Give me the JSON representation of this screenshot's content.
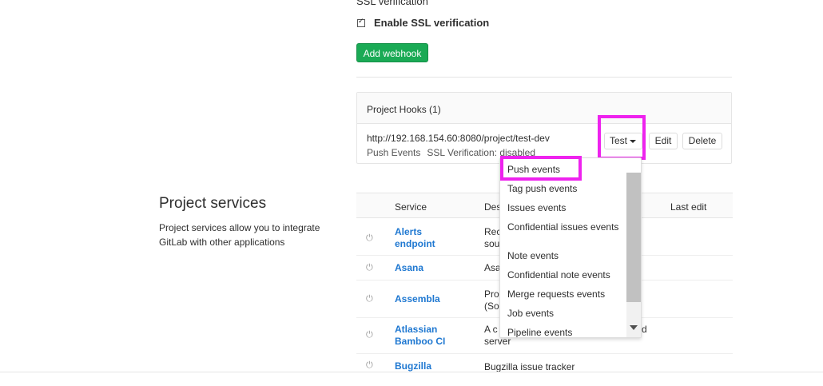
{
  "ssl": {
    "heading": "SSL verification",
    "checkbox_label": "Enable SSL verification",
    "checked": true
  },
  "add_webhook_label": "Add webhook",
  "hooks": {
    "title": "Project Hooks (1)",
    "url": "http://192.168.154.60:8080/project/test-dev",
    "tags": [
      "Push Events",
      "SSL Verification: disabled"
    ],
    "test_label": "Test",
    "edit_label": "Edit",
    "delete_label": "Delete"
  },
  "services": {
    "title": "Project services",
    "description": "Project services allow you to integrate GitLab with other applications",
    "columns": [
      "Service",
      "Des",
      "Last edit"
    ],
    "rows": [
      {
        "name": "Alerts endpoint",
        "desc": "Rec sou"
      },
      {
        "name": "Asana",
        "desc": "Asa"
      },
      {
        "name": "Assembla",
        "desc": "Pro (So"
      },
      {
        "name": "Atlassian Bamboo CI",
        "desc": "A c server",
        "desc_suffix": "d"
      },
      {
        "name": "Bugzilla",
        "desc": "Bugzilla issue tracker"
      }
    ]
  },
  "test_dropdown": {
    "items": [
      "Push events",
      "Tag push events",
      "Issues events",
      "Confidential issues events",
      "Note events",
      "Confidential note events",
      "Merge requests events",
      "Job events",
      "Pipeline events"
    ],
    "highlighted": "Push events"
  },
  "colors": {
    "accent_green": "#1aaa55",
    "link_blue": "#1f78d1",
    "highlight": "#ee22ee"
  }
}
